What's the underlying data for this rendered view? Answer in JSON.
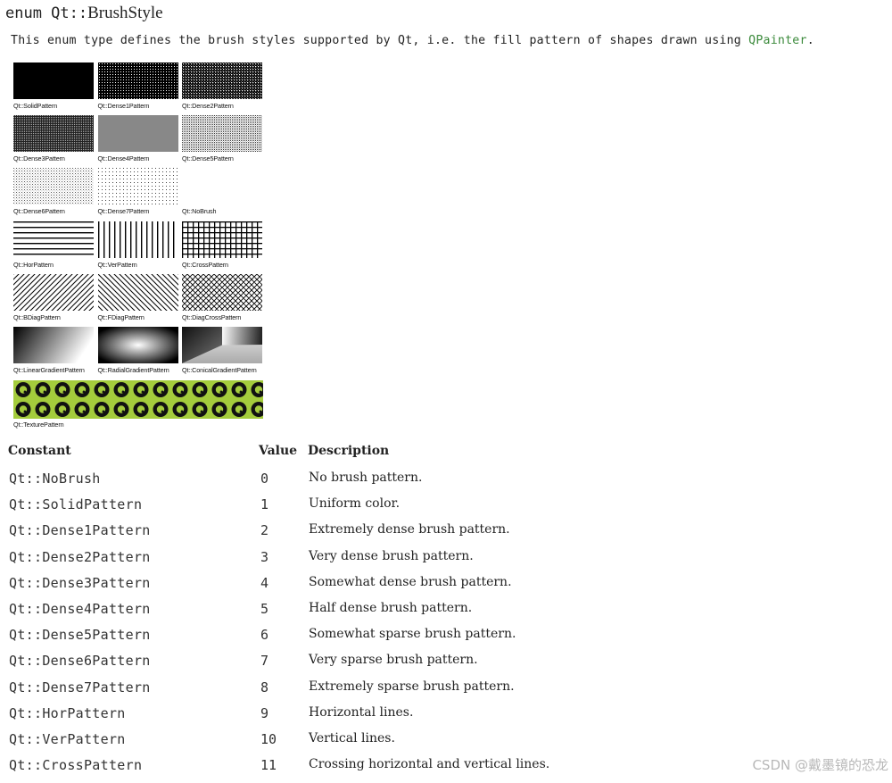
{
  "heading": {
    "prefix": "enum Qt::",
    "name": "BrushStyle"
  },
  "intro": {
    "text_before": "This enum type defines the brush styles supported by Qt, i.e. the fill pattern of shapes drawn using ",
    "link": "QPainter",
    "text_after": "."
  },
  "swatches": [
    {
      "caption": "Qt::SolidPattern",
      "pattern": "solid"
    },
    {
      "caption": "Qt::Dense1Pattern",
      "pattern": "dense1"
    },
    {
      "caption": "Qt::Dense2Pattern",
      "pattern": "dense2"
    },
    {
      "caption": "Qt::Dense3Pattern",
      "pattern": "dense3"
    },
    {
      "caption": "Qt::Dense4Pattern",
      "pattern": "dense4"
    },
    {
      "caption": "Qt::Dense5Pattern",
      "pattern": "dense5"
    },
    {
      "caption": "Qt::Dense6Pattern",
      "pattern": "dense6"
    },
    {
      "caption": "Qt::Dense7Pattern",
      "pattern": "dense7"
    },
    {
      "caption": "Qt::NoBrush",
      "pattern": "none"
    },
    {
      "caption": "Qt::HorPattern",
      "pattern": "hor"
    },
    {
      "caption": "Qt::VerPattern",
      "pattern": "ver"
    },
    {
      "caption": "Qt::CrossPattern",
      "pattern": "cross"
    },
    {
      "caption": "Qt::BDiagPattern",
      "pattern": "bdiag"
    },
    {
      "caption": "Qt::FDiagPattern",
      "pattern": "fdiag"
    },
    {
      "caption": "Qt::DiagCrossPattern",
      "pattern": "diagcross"
    },
    {
      "caption": "Qt::LinearGradientPattern",
      "pattern": "linear"
    },
    {
      "caption": "Qt::RadialGradientPattern",
      "pattern": "radial"
    },
    {
      "caption": "Qt::ConicalGradientPattern",
      "pattern": "conical"
    }
  ],
  "texture": {
    "caption": "Qt::TexturePattern",
    "color": "#a4cc3c",
    "icon": "qt-logo-icon"
  },
  "table": {
    "headers": {
      "constant": "Constant",
      "value": "Value",
      "description": "Description"
    },
    "rows": [
      {
        "constant": "Qt::NoBrush",
        "value": "0",
        "description": "No brush pattern."
      },
      {
        "constant": "Qt::SolidPattern",
        "value": "1",
        "description": "Uniform color."
      },
      {
        "constant": "Qt::Dense1Pattern",
        "value": "2",
        "description": "Extremely dense brush pattern."
      },
      {
        "constant": "Qt::Dense2Pattern",
        "value": "3",
        "description": "Very dense brush pattern."
      },
      {
        "constant": "Qt::Dense3Pattern",
        "value": "4",
        "description": "Somewhat dense brush pattern."
      },
      {
        "constant": "Qt::Dense4Pattern",
        "value": "5",
        "description": "Half dense brush pattern."
      },
      {
        "constant": "Qt::Dense5Pattern",
        "value": "6",
        "description": "Somewhat sparse brush pattern."
      },
      {
        "constant": "Qt::Dense6Pattern",
        "value": "7",
        "description": "Very sparse brush pattern."
      },
      {
        "constant": "Qt::Dense7Pattern",
        "value": "8",
        "description": "Extremely sparse brush pattern."
      },
      {
        "constant": "Qt::HorPattern",
        "value": "9",
        "description": "Horizontal lines."
      },
      {
        "constant": "Qt::VerPattern",
        "value": "10",
        "description": "Vertical lines."
      },
      {
        "constant": "Qt::CrossPattern",
        "value": "11",
        "description": "Crossing horizontal and vertical lines."
      }
    ]
  },
  "watermark": "CSDN @戴墨镜的恐龙"
}
